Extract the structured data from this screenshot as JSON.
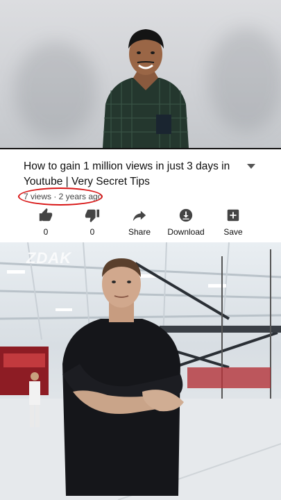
{
  "video": {
    "title": "How to gain 1 million views in just 3 days in Youtube | Very Secret Tips",
    "meta": "7 views · 2 years ago"
  },
  "actions": [
    {
      "name": "like",
      "icon": "thumbs-up-icon",
      "label": "0"
    },
    {
      "name": "dislike",
      "icon": "thumbs-down-icon",
      "label": "0"
    },
    {
      "name": "share",
      "icon": "share-icon",
      "label": "Share"
    },
    {
      "name": "download",
      "icon": "download-icon",
      "label": "Download"
    },
    {
      "name": "save",
      "icon": "playlist-add-icon",
      "label": "Save"
    }
  ],
  "overlay": {
    "watermark": "ZDAK"
  },
  "colors": {
    "highlight": "#d81414",
    "text": "#0f0f0f",
    "icon": "#444444"
  }
}
